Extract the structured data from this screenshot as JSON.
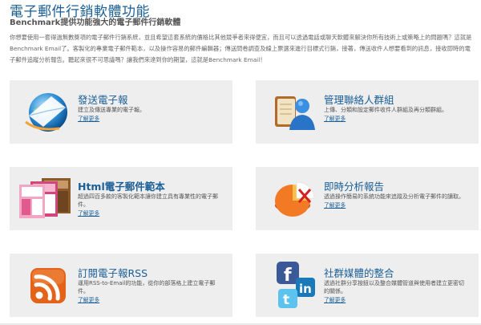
{
  "header": {
    "title": "電子郵件行銷軟體功能",
    "subtitle": "Benchmark提供功能強大的電子郵件行銷軟體",
    "intro": "你想要使用一套得過無數獎項的電子郵件行銷系統，並且希望這套系統的價格比其他競爭者來得便宜，而且可以透過電話或聊天軟體來解決你所有技術上或策略上的問題嗎？這就是Benchmark Email了。客製化的專業電子郵件範本，以及操作容易的郵件編輯器；傳送問卷調查及線上票選來進行目標式行銷，接著，傳送收件人想要看到的訊息，接收即時的電子郵件追蹤分析報告。聽起來很不可思議嗎？讓我們來達到你的期望，這就是Benchmark Email！"
  },
  "features": [
    {
      "title": "發送電子報",
      "desc": "建立及傳送專業的電子報。",
      "more": "了解更多",
      "icon": "send-newsletter-icon"
    },
    {
      "title": "管理聯絡人群組",
      "desc": "上傳、分類和設定郵件收件人群組及再分類群組。",
      "more": "了解更多",
      "icon": "contacts-icon"
    },
    {
      "title": "Html電子郵件範本",
      "desc": "超過四百多款的客製化範本讓你建立具有專業性的電子郵件。",
      "more": "了解更多",
      "icon": "templates-icon"
    },
    {
      "title": "即時分析報告",
      "desc": "透過操作簡易的系統功能來追蹤及分析電子郵件的讀取。",
      "more": "了解更多",
      "icon": "pie-chart-icon"
    },
    {
      "title": "訂閱電子報RSS",
      "desc": "運用RSS-to-Email的功能，從你的部落格上建立電子郵件。",
      "more": "了解更多",
      "icon": "rss-icon"
    },
    {
      "title": "社群媒體的整合",
      "desc": "透過社群分享按鈕以及整合媒體管道與使用者建立更密切的關係。",
      "more": "了解更多",
      "icon": "social-media-icon"
    }
  ],
  "colors": {
    "title": "#1a5f96",
    "card_bg": "#eeeeee"
  }
}
